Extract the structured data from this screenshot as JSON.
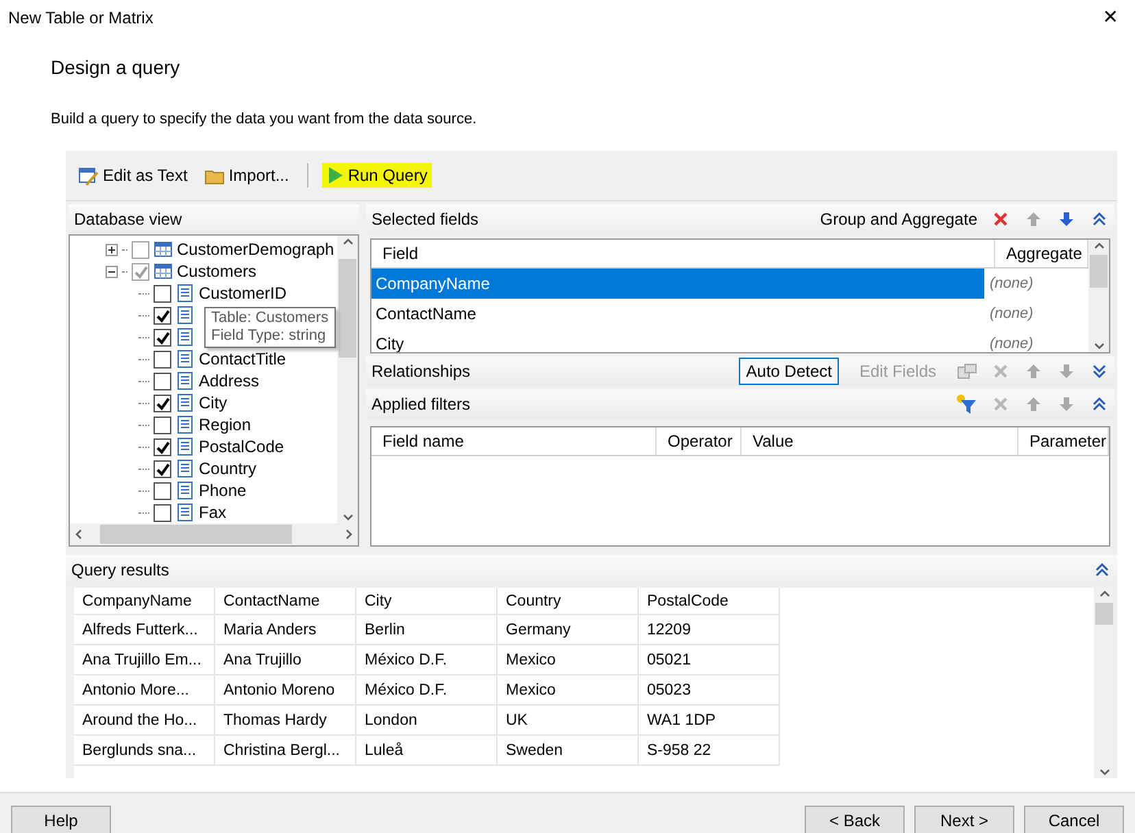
{
  "window": {
    "title": "New Table or Matrix",
    "close": "✕"
  },
  "header": {
    "title": "Design a query",
    "description": "Build a query to specify the data you want from the data source."
  },
  "toolbar": [
    {
      "kind": "edit",
      "label": "Edit as Text",
      "highlighted": false
    },
    {
      "kind": "import",
      "label": "Import...",
      "highlighted": false
    },
    {
      "kind": "run",
      "label": "Run Query",
      "highlighted": true
    }
  ],
  "database_view": {
    "title": "Database view",
    "tree": [
      {
        "label": "CustomerDemograph",
        "kind": "table",
        "expanded": false,
        "checked": false
      },
      {
        "label": "Customers",
        "kind": "table",
        "expanded": true,
        "checked": true,
        "children": [
          {
            "label": "CustomerID",
            "checked": false
          },
          {
            "checked": true
          },
          {
            "checked": true
          },
          {
            "label": "ContactTitle",
            "checked": false
          },
          {
            "label": "Address",
            "checked": false
          },
          {
            "label": "City",
            "checked": true
          },
          {
            "label": "Region",
            "checked": false
          },
          {
            "label": "PostalCode",
            "checked": true
          },
          {
            "label": "Country",
            "checked": true
          },
          {
            "label": "Phone",
            "checked": false
          },
          {
            "label": "Fax",
            "checked": false
          }
        ]
      }
    ],
    "tooltip": [
      "Table: Customers",
      "Field Type: string"
    ]
  },
  "selected_fields": {
    "title": "Selected fields",
    "group_label": "Group and Aggregate",
    "columns": [
      "Field",
      "Aggregate"
    ],
    "rows": [
      {
        "field": "CompanyName",
        "aggregate": "(none)",
        "selected": true
      },
      {
        "field": "ContactName",
        "aggregate": "(none)",
        "selected": false
      },
      {
        "field": "City",
        "aggregate": "(none)",
        "selected": false
      }
    ]
  },
  "relationships": {
    "title": "Relationships",
    "buttons": [
      {
        "label": "Auto Detect",
        "disabled": false
      },
      {
        "label": "Edit Fields",
        "disabled": true
      }
    ]
  },
  "applied_filters": {
    "title": "Applied filters",
    "columns": [
      "Field name",
      "Operator",
      "Value",
      "Parameter"
    ]
  },
  "query_results": {
    "title": "Query results",
    "columns": [
      "CompanyName",
      "ContactName",
      "City",
      "Country",
      "PostalCode"
    ],
    "rows": [
      [
        "Alfreds Futterk...",
        "Maria Anders",
        "Berlin",
        "Germany",
        "12209"
      ],
      [
        "Ana Trujillo Em...",
        "Ana Trujillo",
        "México D.F.",
        "Mexico",
        "05021"
      ],
      [
        "Antonio More...",
        "Antonio Moreno",
        "México D.F.",
        "Mexico",
        "05023"
      ],
      [
        "Around the Ho...",
        "Thomas Hardy",
        "London",
        "UK",
        "WA1 1DP"
      ],
      [
        "Berglunds sna...",
        "Christina Bergl...",
        "Luleå",
        "Sweden",
        "S-958 22"
      ]
    ]
  },
  "footer": {
    "left": [
      "Help"
    ],
    "right": [
      "< Back",
      "Next >",
      "Cancel"
    ]
  }
}
